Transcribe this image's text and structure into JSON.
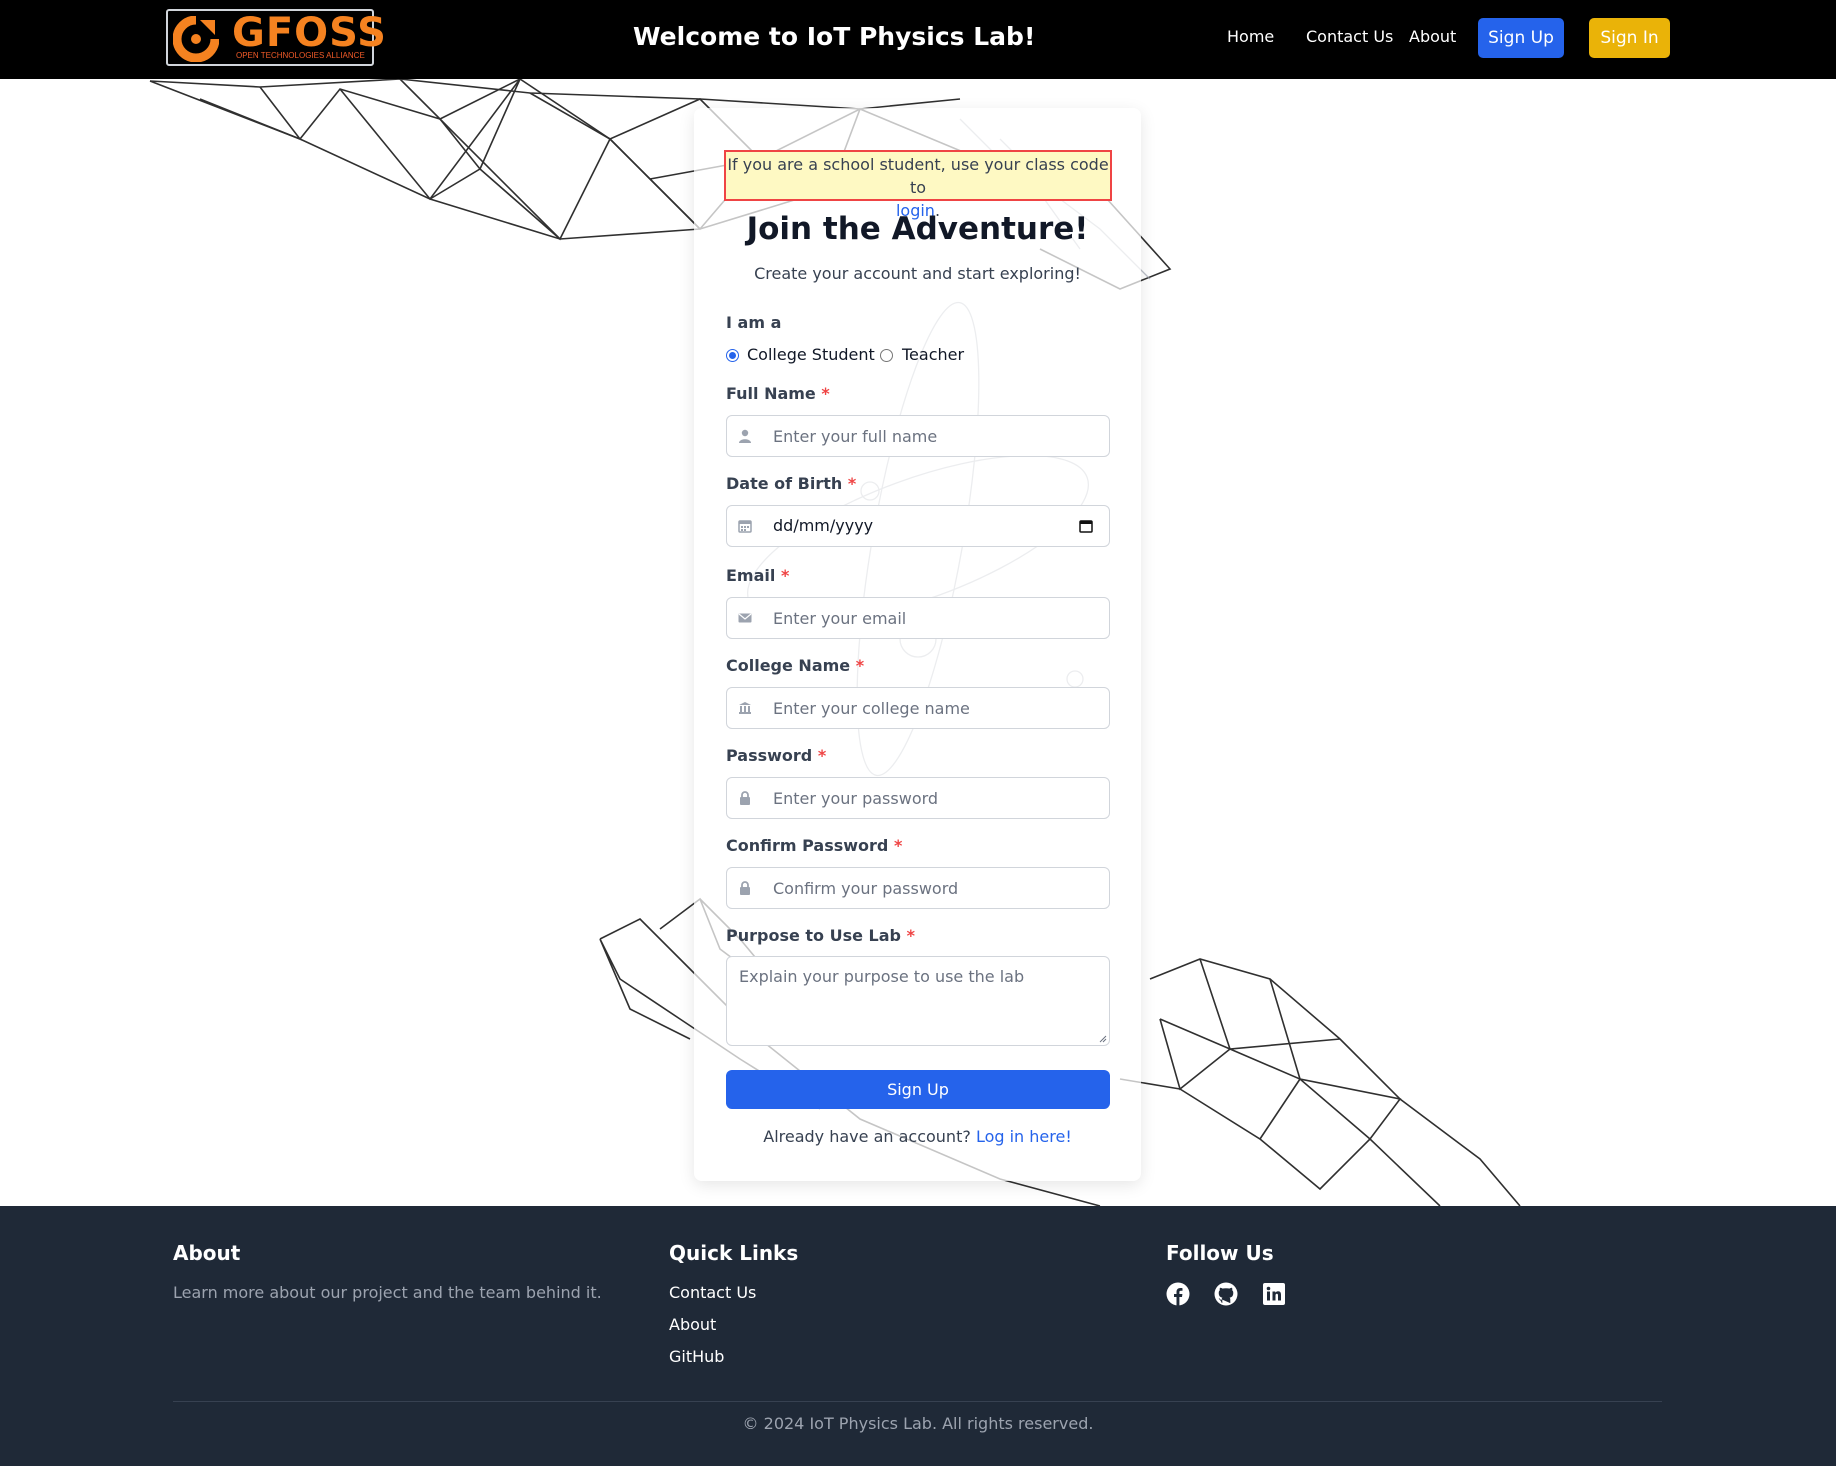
{
  "navbar": {
    "logo_text": "GFOSS",
    "logo_subtext": "OPEN TECHNOLOGIES ALLIANCE",
    "title": "Welcome to IoT Physics Lab!",
    "links": [
      "Home",
      "Contact Us",
      "About"
    ],
    "signup_label": "Sign Up",
    "signin_label": "Sign In"
  },
  "card": {
    "notice_text": "If you are a school student, use your class code to",
    "notice_link": "login",
    "notice_end": ".",
    "title": "Join the Adventure!",
    "subtitle": "Create your account and start exploring!",
    "role_label": "I am a",
    "roles": [
      {
        "label": "College Student",
        "checked": true
      },
      {
        "label": "Teacher",
        "checked": false
      }
    ],
    "required_mark": "*",
    "fields": {
      "full_name": {
        "label": "Full Name",
        "placeholder": "Enter your full name",
        "icon": "user-icon"
      },
      "dob": {
        "label": "Date of Birth",
        "value": "dd/mm/yyyy",
        "icon": "calendar-icon"
      },
      "email": {
        "label": "Email",
        "placeholder": "Enter your email",
        "icon": "envelope-icon"
      },
      "college": {
        "label": "College Name",
        "placeholder": "Enter your college name",
        "icon": "university-icon"
      },
      "password": {
        "label": "Password",
        "placeholder": "Enter your password",
        "icon": "lock-icon"
      },
      "confirm": {
        "label": "Confirm Password",
        "placeholder": "Confirm your password",
        "icon": "lock-icon"
      },
      "purpose": {
        "label": "Purpose to Use Lab",
        "placeholder": "Explain your purpose to use the lab"
      }
    },
    "submit_label": "Sign Up",
    "already_text": "Already have an account?",
    "login_link": "Log in here!"
  },
  "footer": {
    "about_heading": "About",
    "about_text": "Learn more about our project and the team behind it.",
    "links_heading": "Quick Links",
    "links": [
      "Contact Us",
      "About",
      "GitHub"
    ],
    "follow_heading": "Follow Us",
    "social": [
      "facebook-icon",
      "github-icon",
      "linkedin-icon"
    ],
    "copyright": "© 2024 IoT Physics Lab. All rights reserved."
  },
  "colors": {
    "primary": "#2563eb",
    "accent": "#eab308",
    "logo": "#f58220",
    "footer_bg": "#1f2937",
    "navbar_bg": "#000000",
    "required": "#ef4444",
    "notice_bg": "#fef9c3"
  }
}
